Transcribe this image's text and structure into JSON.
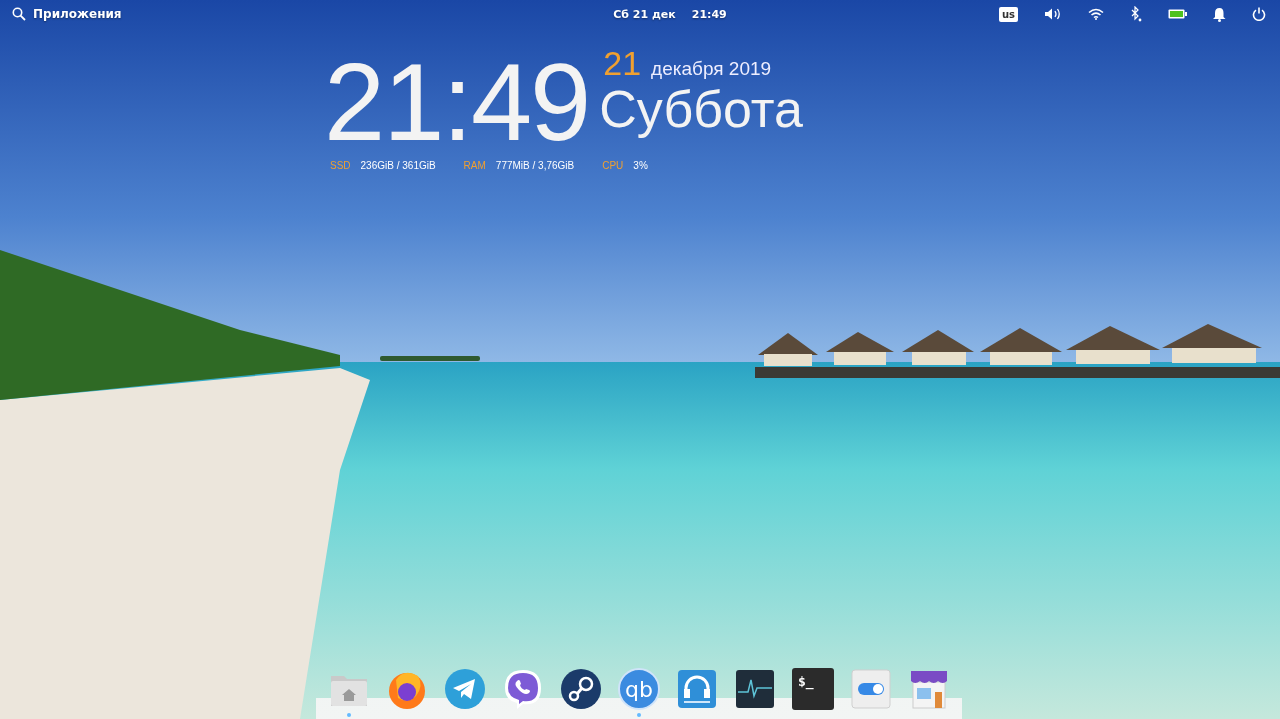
{
  "top_bar": {
    "apps_label": "Приложения",
    "date": "Сб 21 дек",
    "time": "21:49",
    "indicators": [
      {
        "kind": "keyboard",
        "label": "us"
      },
      {
        "kind": "volume"
      },
      {
        "kind": "wifi"
      },
      {
        "kind": "bluetooth"
      },
      {
        "kind": "battery"
      },
      {
        "kind": "notifications"
      },
      {
        "kind": "power"
      }
    ]
  },
  "clock_widget": {
    "time": "21:49",
    "day": "21",
    "month_year": "декабря 2019",
    "weekday": "Суббота",
    "stats": [
      {
        "label": "SSD",
        "value": "236GiB / 361GiB"
      },
      {
        "label": "RAM",
        "value": "777MiB / 3,76GiB"
      },
      {
        "label": "CPU",
        "value": "3%"
      }
    ]
  },
  "dock": [
    {
      "kind": "files",
      "running": true
    },
    {
      "kind": "browser",
      "running": false
    },
    {
      "kind": "messenger",
      "running": false
    },
    {
      "kind": "phone",
      "running": false
    },
    {
      "kind": "games",
      "running": false
    },
    {
      "kind": "torrent",
      "glyph": "qb",
      "running": true
    },
    {
      "kind": "audio",
      "running": false
    },
    {
      "kind": "monitor",
      "running": false
    },
    {
      "kind": "terminal",
      "glyph": "$_",
      "running": false
    },
    {
      "kind": "settings",
      "running": false
    },
    {
      "kind": "store",
      "running": false
    }
  ]
}
